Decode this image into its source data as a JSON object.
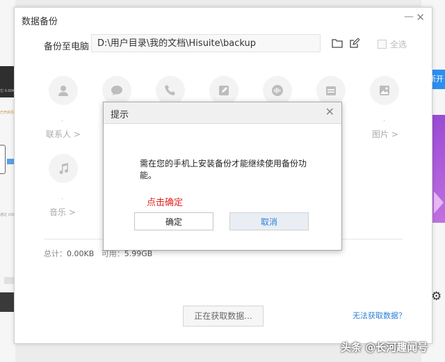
{
  "window": {
    "title": "数据备份",
    "minimize_glyph": "—",
    "close_glyph": "✕"
  },
  "backup_path": {
    "label": "备份至电脑",
    "value": "D:\\用户目录\\我的文档\\Hisuite\\backup",
    "select_all_label": "全选"
  },
  "categories": [
    {
      "icon": "contacts-icon",
      "label": "联系人 >"
    },
    {
      "icon": "messages-icon",
      "label": ""
    },
    {
      "icon": "call-log-icon",
      "label": ""
    },
    {
      "icon": "memo-icon",
      "label": ""
    },
    {
      "icon": "recorder-icon",
      "label": ""
    },
    {
      "icon": "calendar-icon",
      "label": ""
    },
    {
      "icon": "pictures-icon",
      "label": "图片 >"
    },
    {
      "icon": "music-icon",
      "label": "音乐 >"
    }
  ],
  "stats": {
    "total_label": "总计：",
    "total_value": "0.00KB",
    "available_label": "可用：",
    "available_value": "5.99GB"
  },
  "footer": {
    "loading_button": "正在获取数据...",
    "help_link": "无法获取数据？"
  },
  "dialog": {
    "title": "提示",
    "close_glyph": "✕",
    "message": "需在您的手机上安装备份才能继续使用备份功能。",
    "hint": "点击确定",
    "ok_label": "确定",
    "cancel_label": "取消"
  },
  "background": {
    "right_button_text": "断开",
    "left_texts": [
      "它 0.00KB",
      "已开启页",
      "通过 USB"
    ]
  },
  "watermark": "头条 @长河趣闻号",
  "colors": {
    "accent_blue": "#2b7fd8",
    "hint_red": "#e0231a",
    "icon_gray": "#bdbdbd"
  }
}
